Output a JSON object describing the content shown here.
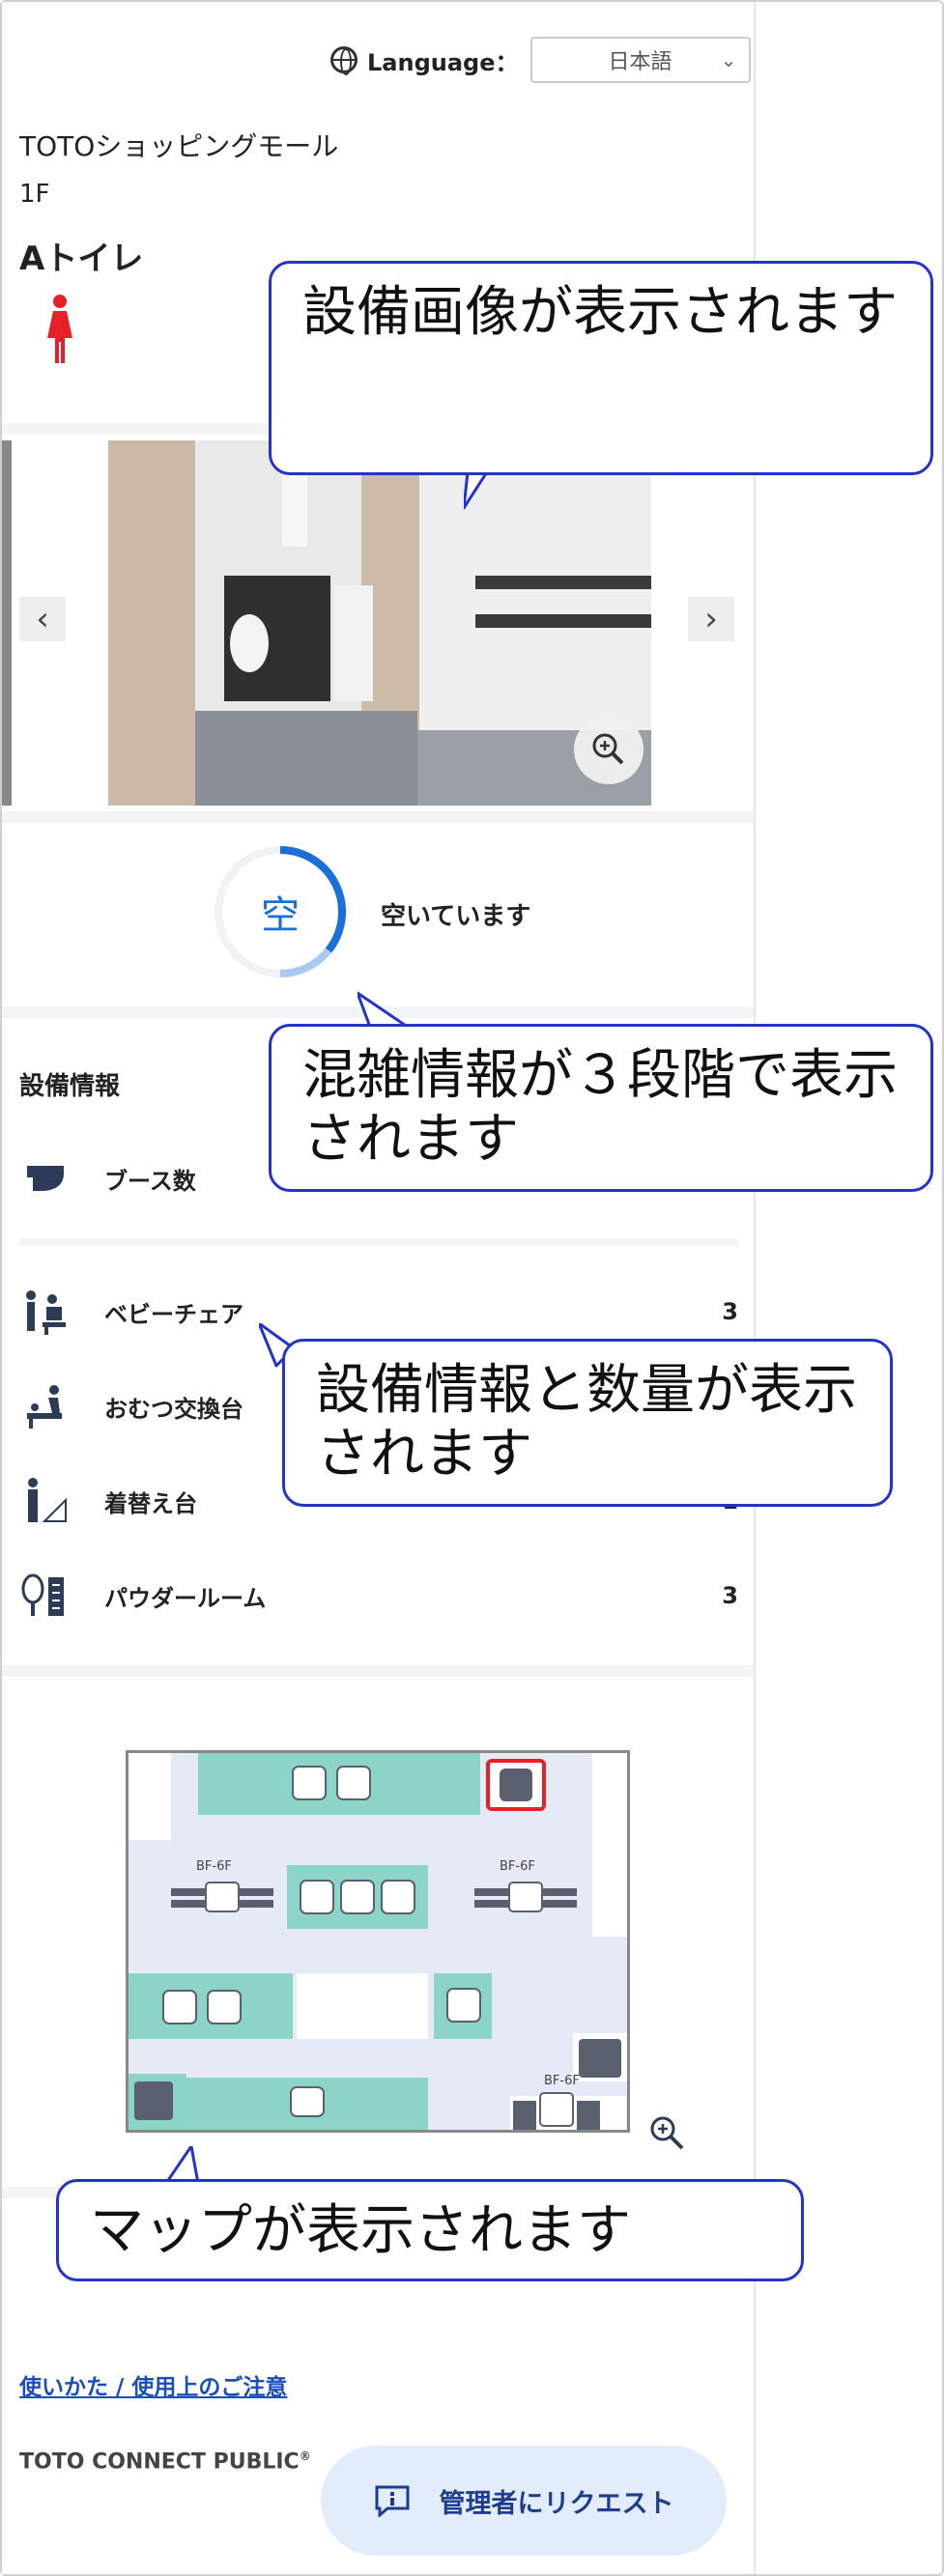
{
  "header": {
    "language_label": "Language：",
    "language_value": "日本語",
    "chevron": "chevron-down-icon"
  },
  "facility": {
    "name": "TOTOショッピングモール",
    "floor": "1F",
    "toilet_name": "Aトイレ",
    "gender_icon": "female-icon",
    "gender_color": "#e8202a"
  },
  "carousel": {
    "prev": "‹",
    "next": "›",
    "zoom_icon": "zoom-in-icon"
  },
  "congestion": {
    "ring_label": "空",
    "status_text": "空いています",
    "accent": "#1a6fd8"
  },
  "equipment": {
    "title": "設備情報",
    "booth": {
      "label": "ブース数",
      "icon": "booth-icon"
    },
    "items": [
      {
        "label": "ベビーチェア",
        "value": "3",
        "icon": "baby-chair-icon"
      },
      {
        "label": "おむつ交換台",
        "value": "",
        "icon": "diaper-changing-icon"
      },
      {
        "label": "着替え台",
        "value": "1",
        "icon": "changing-board-icon"
      },
      {
        "label": "パウダールーム",
        "value": "3",
        "icon": "powder-room-icon"
      }
    ]
  },
  "map": {
    "floor_labels": [
      "BF-6F",
      "BF-6F",
      "BF-6F"
    ],
    "zoom_icon": "zoom-in-icon",
    "teal": "#8dd4c8"
  },
  "callouts": {
    "image": "設備画像が表示されます",
    "congestion": "混雑情報が３段階で表示されます",
    "equipment": "設備情報と数量が表示されます",
    "map": "マップが表示されます",
    "color": "#2433c8"
  },
  "footer": {
    "link": "使いかた / 使用上のご注意",
    "brand": "TOTO CONNECT PUBLIC",
    "brand_mark": "®",
    "request_button": "管理者にリクエスト"
  }
}
